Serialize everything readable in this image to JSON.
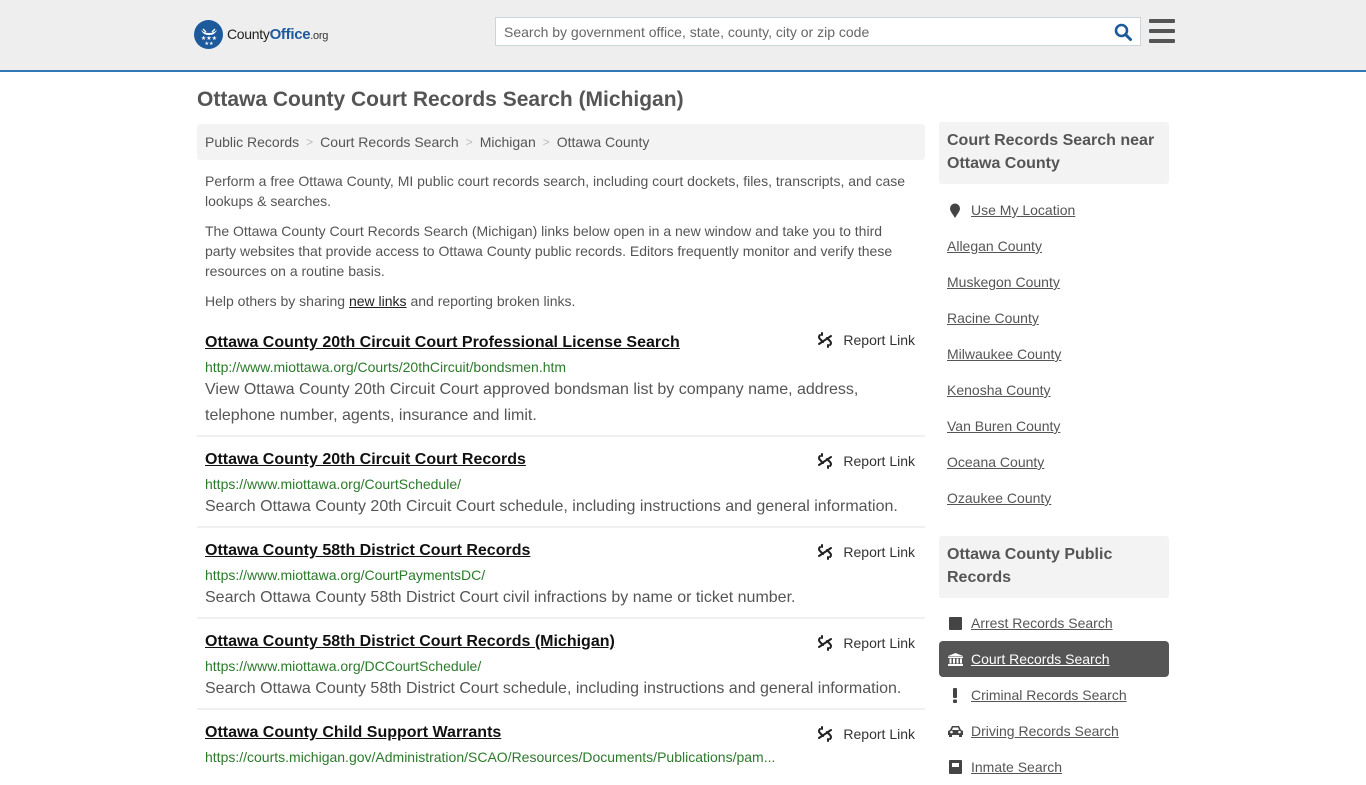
{
  "header": {
    "logo": {
      "name_part1": "County",
      "name_part2": "Office",
      "suffix": ".org"
    },
    "search": {
      "placeholder": "Search by government office, state, county, city or zip code",
      "value": ""
    },
    "accent_color": "#2f78b5"
  },
  "page": {
    "title": "Ottawa County Court Records Search (Michigan)"
  },
  "breadcrumb": [
    {
      "label": "Public Records"
    },
    {
      "label": "Court Records Search"
    },
    {
      "label": "Michigan"
    },
    {
      "label": "Ottawa County"
    }
  ],
  "breadcrumb_separator": ">",
  "intro": {
    "p1": "Perform a free Ottawa County, MI public court records search, including court dockets, files, transcripts, and case lookups & searches.",
    "p2": "The Ottawa County Court Records Search (Michigan) links below open in a new window and take you to third party websites that provide access to Ottawa County public records. Editors frequently monitor and verify these resources on a routine basis.",
    "p3_before": "Help others by sharing ",
    "p3_link": "new links",
    "p3_after": " and reporting broken links."
  },
  "results": [
    {
      "title": "Ottawa County 20th Circuit Court Professional License Search",
      "url": "http://www.miottawa.org/Courts/20thCircuit/bondsmen.htm",
      "description": "View Ottawa County 20th Circuit Court approved bondsman list by company name, address, telephone number, agents, insurance and limit.",
      "report_label": "Report Link"
    },
    {
      "title": "Ottawa County 20th Circuit Court Records",
      "url": "https://www.miottawa.org/CourtSchedule/",
      "description": "Search Ottawa County 20th Circuit Court schedule, including instructions and general information.",
      "report_label": "Report Link"
    },
    {
      "title": "Ottawa County 58th District Court Records",
      "url": "https://www.miottawa.org/CourtPaymentsDC/",
      "description": "Search Ottawa County 58th District Court civil infractions by name or ticket number.",
      "report_label": "Report Link"
    },
    {
      "title": "Ottawa County 58th District Court Records (Michigan)",
      "url": "https://www.miottawa.org/DCCourtSchedule/",
      "description": "Search Ottawa County 58th District Court schedule, including instructions and general information.",
      "report_label": "Report Link"
    },
    {
      "title": "Ottawa County Child Support Warrants",
      "url": "https://courts.michigan.gov/Administration/SCAO/Resources/Documents/Publications/pam...",
      "description": "",
      "report_label": "Report Link"
    }
  ],
  "sidebar": {
    "nearby": {
      "heading": "Court Records Search near Ottawa County",
      "use_location": "Use My Location",
      "counties": [
        "Allegan County",
        "Muskegon County",
        "Racine County",
        "Milwaukee County",
        "Kenosha County",
        "Van Buren County",
        "Oceana County",
        "Ozaukee County"
      ]
    },
    "public_records": {
      "heading": "Ottawa County Public Records",
      "items": [
        {
          "label": "Arrest Records Search",
          "icon": "square-icon",
          "active": false
        },
        {
          "label": "Court Records Search",
          "icon": "courthouse-icon",
          "active": true
        },
        {
          "label": "Criminal Records Search",
          "icon": "exclamation-icon",
          "active": false
        },
        {
          "label": "Driving Records Search",
          "icon": "car-icon",
          "active": false
        },
        {
          "label": "Inmate Search",
          "icon": "inmate-icon",
          "active": false
        }
      ]
    }
  }
}
